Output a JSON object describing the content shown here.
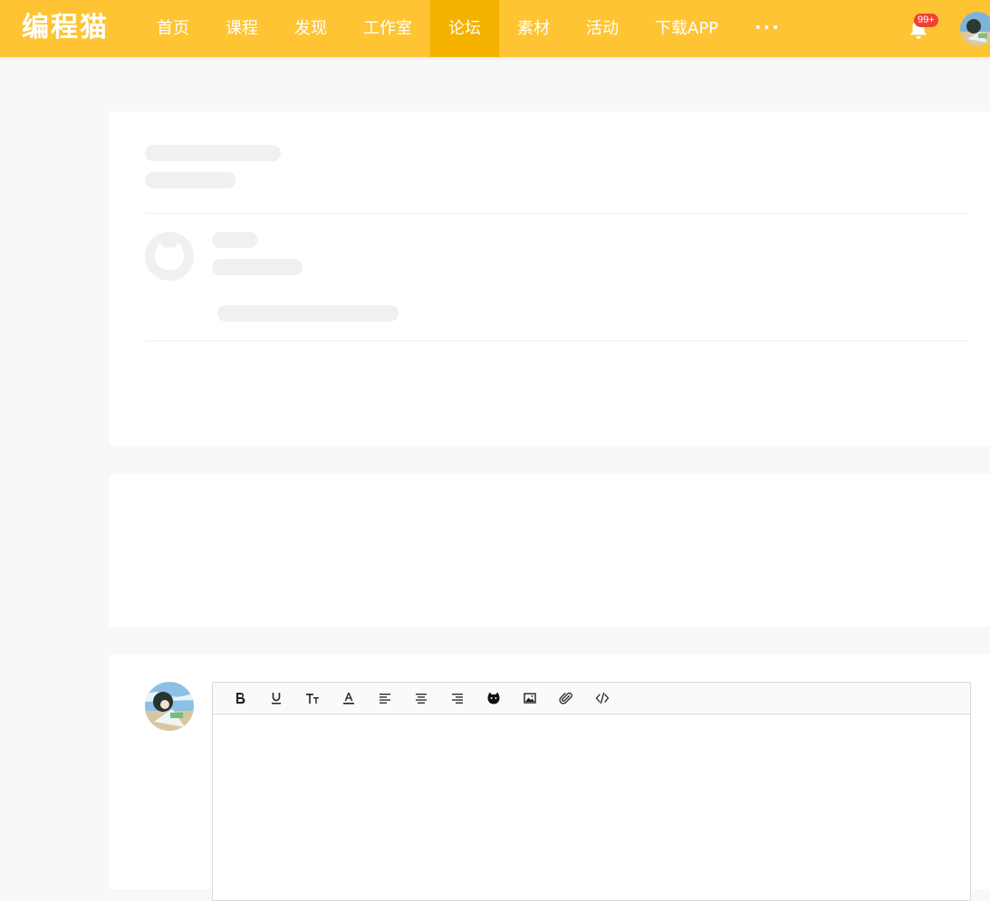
{
  "brand": {
    "logo_text": "编程猫",
    "accent": "#fec433",
    "active_bg": "#f5b100"
  },
  "nav": {
    "items": [
      {
        "label": "首页",
        "active": false
      },
      {
        "label": "课程",
        "active": false
      },
      {
        "label": "发现",
        "active": false
      },
      {
        "label": "工作室",
        "active": false
      },
      {
        "label": "论坛",
        "active": true
      },
      {
        "label": "素材",
        "active": false
      },
      {
        "label": "活动",
        "active": false
      },
      {
        "label": "下载APP",
        "active": false
      }
    ],
    "more_label": "···",
    "notification_count": "99+"
  },
  "editor": {
    "toolbar": [
      {
        "name": "bold",
        "icon": "bold-icon"
      },
      {
        "name": "underline",
        "icon": "underline-icon"
      },
      {
        "name": "font-size",
        "icon": "font-size-icon"
      },
      {
        "name": "font-color",
        "icon": "font-color-icon"
      },
      {
        "name": "align-left",
        "icon": "align-left-icon"
      },
      {
        "name": "align-center",
        "icon": "align-center-icon"
      },
      {
        "name": "align-right",
        "icon": "align-right-icon"
      },
      {
        "name": "emoji",
        "icon": "cat-emoji-icon"
      },
      {
        "name": "image",
        "icon": "image-icon"
      },
      {
        "name": "attachment",
        "icon": "paperclip-icon"
      },
      {
        "name": "code",
        "icon": "code-icon"
      }
    ],
    "content": ""
  }
}
